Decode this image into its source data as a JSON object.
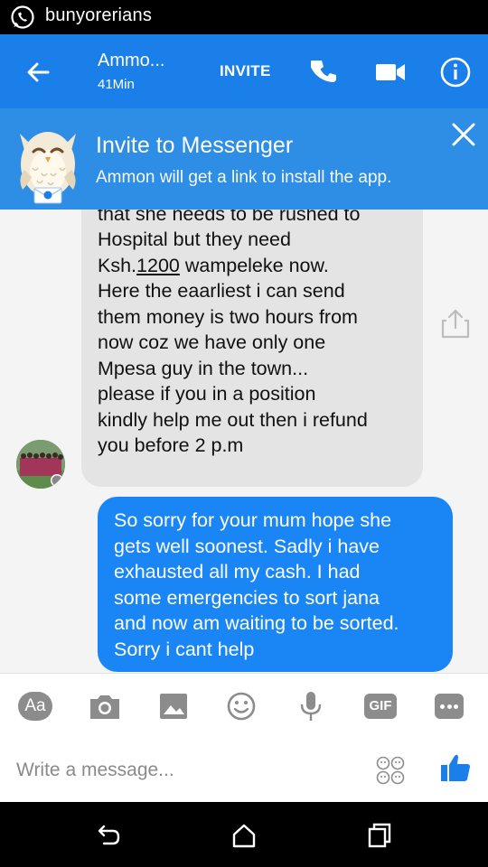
{
  "status_bar": {
    "app_name": "bunyorerians"
  },
  "header": {
    "contact_name": "Ammo...",
    "active_status": "41Min",
    "invite_label": "INVITE"
  },
  "banner": {
    "title": "Invite to Messenger",
    "subtitle": "Ammon will get a link to install the app."
  },
  "messages": {
    "incoming": {
      "text_before": "mum and just been informed\nthat she needs to be rushed to\nHospital but they need\nKsh.",
      "amount": "1200",
      "text_after": " wampeleke now.\nHere the eaarliest i can send\nthem money is two hours from\nnow coz  we have only one\nMpesa guy in the town...\nplease if you in a position\nkindly help me out then i refund\nyou before  2 p.m"
    },
    "outgoing": {
      "text": "So sorry for your mum hope she\ngets well soonest. Sadly i have\nexhausted all my cash. I had\nsome emergencies to sort jana\nand now am waiting to be sorted.\nSorry i cant help"
    }
  },
  "composer": {
    "aa_label": "Aa",
    "gif_label": "GIF",
    "placeholder": "Write a message..."
  },
  "colors": {
    "brand_blue": "#1a7fe8",
    "banner_blue": "#2e8de4",
    "outgoing_bubble": "#1a86f5",
    "incoming_bubble": "#e4e4e4"
  },
  "icons": [
    "whatsapp-icon",
    "back-arrow-icon",
    "phone-icon",
    "video-camera-icon",
    "info-icon",
    "owl-mascot-icon",
    "close-icon",
    "share-icon",
    "camera-icon",
    "image-icon",
    "smiley-icon",
    "microphone-icon",
    "more-icon",
    "emoji-grid-icon",
    "thumbs-up-icon",
    "nav-back-icon",
    "nav-home-icon",
    "nav-recents-icon"
  ]
}
